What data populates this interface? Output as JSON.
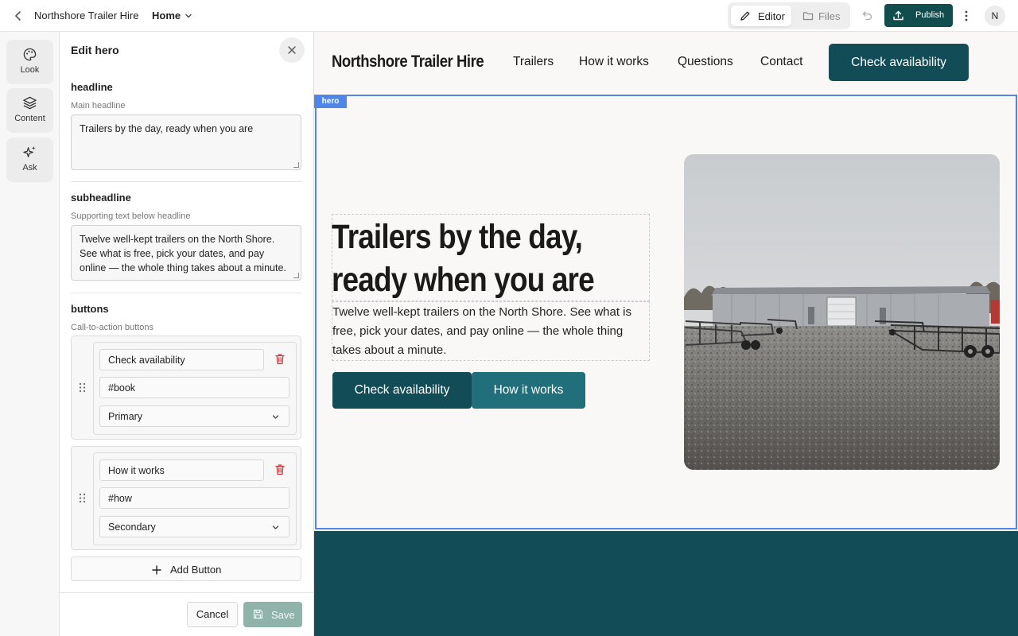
{
  "topbar": {
    "site_name": "Northshore Trailer Hire",
    "page": "Home",
    "modes": {
      "editor": "Editor",
      "files": "Files"
    },
    "publish": "Publish",
    "avatar_initial": "N"
  },
  "rail": {
    "items": [
      {
        "label": "Look",
        "icon": "palette-icon"
      },
      {
        "label": "Content",
        "icon": "layers-icon"
      },
      {
        "label": "Ask",
        "icon": "sparkles-icon"
      }
    ]
  },
  "panel": {
    "title": "Edit hero",
    "headline": {
      "title": "headline",
      "subtitle": "Main headline",
      "value": "Trailers by the day, ready when you are"
    },
    "subheadline": {
      "title": "subheadline",
      "subtitle": "Supporting text below headline",
      "value": "Twelve well-kept trailers on the North Shore. See what is free, pick your dates, and pay online — the whole thing takes about a minute."
    },
    "buttons": {
      "title": "buttons",
      "subtitle": "Call-to-action buttons",
      "items": [
        {
          "label": "Check availability",
          "link": "#book",
          "style": "Primary"
        },
        {
          "label": "How it works",
          "link": "#how",
          "style": "Secondary"
        }
      ],
      "add_label": "Add Button"
    },
    "cancel": "Cancel",
    "save": "Save"
  },
  "preview": {
    "brand": "Northshore Trailer Hire",
    "nav": [
      "Trailers",
      "How it works",
      "Questions",
      "Contact"
    ],
    "nav_cta": "Check availability",
    "section_tag": "hero",
    "headline": "Trailers by the day, ready when you are",
    "subheadline": "Twelve well-kept trailers on the North Shore. See what is free, pick your dates, and pay online — the whole thing takes about a minute.",
    "cta_primary": "Check availability",
    "cta_secondary": "How it works"
  },
  "colors": {
    "brand_dark_teal": "#124d57",
    "brand_teal": "#216f7b",
    "publish_green": "#124d4d",
    "selection_blue": "#4f86e8",
    "delete_red": "#d43a3a"
  }
}
